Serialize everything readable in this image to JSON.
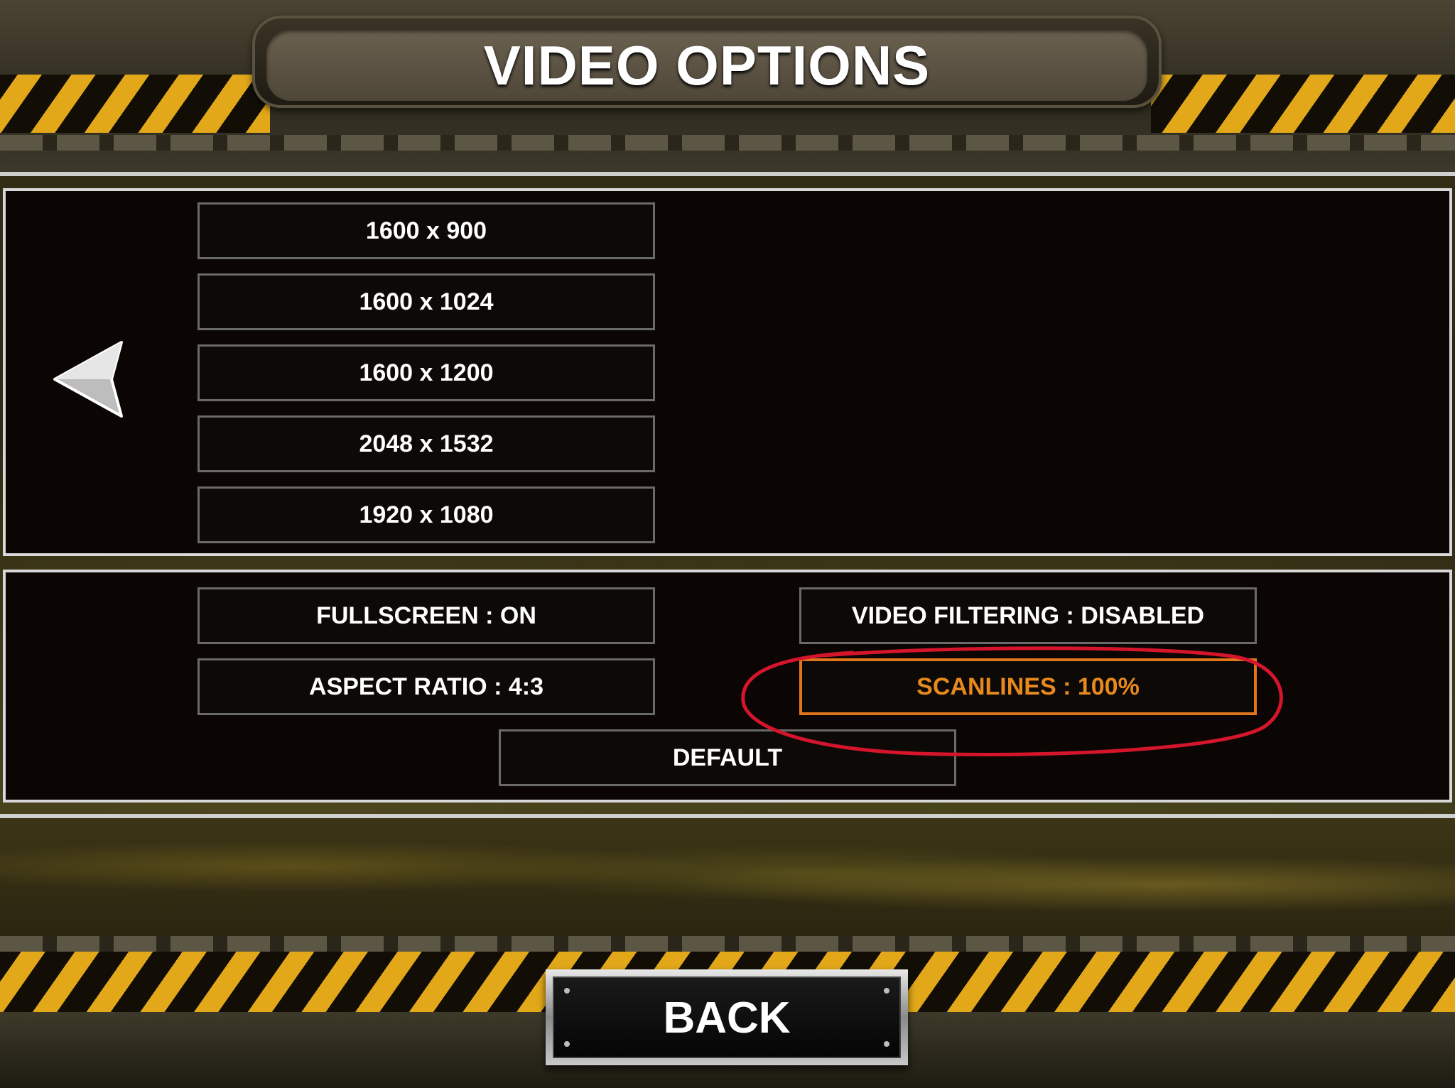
{
  "header": {
    "title": "VIDEO OPTIONS"
  },
  "resolutions": [
    {
      "label": "1600 x 900"
    },
    {
      "label": "1600 x 1024"
    },
    {
      "label": "1600 x 1200"
    },
    {
      "label": "2048 x 1532"
    },
    {
      "label": "1920 x 1080"
    }
  ],
  "settings": {
    "fullscreen": "FULLSCREEN : ON",
    "aspect_ratio": "ASPECT RATIO : 4:3",
    "video_filtering": "VIDEO FILTERING : DISABLED",
    "scanlines": "SCANLINES : 100%",
    "default": "DEFAULT"
  },
  "footer": {
    "back_label": "BACK"
  },
  "icons": {
    "prev_page": "left-arrow-icon"
  },
  "colors": {
    "hazard_yellow": "#e2a81a",
    "selected_orange": "#e8891e",
    "annotation_red": "#d4152c",
    "panel_border": "#d8d8d8"
  }
}
